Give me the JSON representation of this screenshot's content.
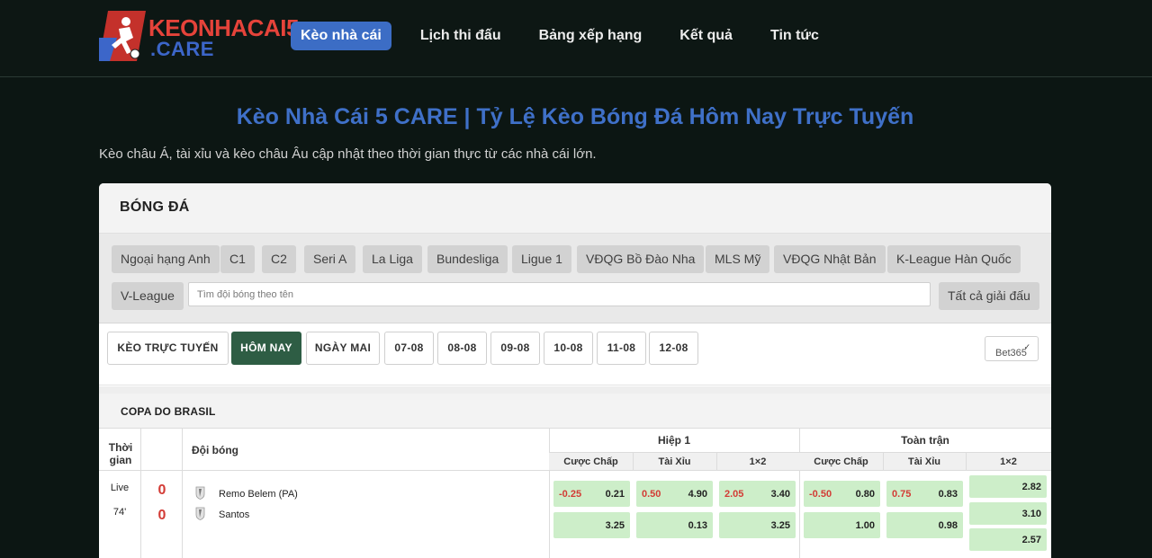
{
  "header": {
    "logo": {
      "line1": "KEONHACAI5",
      "line2": ".CARE"
    },
    "nav": [
      {
        "label": "Kèo nhà cái",
        "active": true
      },
      {
        "label": "Lịch thi đấu",
        "active": false
      },
      {
        "label": "Bảng xếp hạng",
        "active": false
      },
      {
        "label": "Kết quả",
        "active": false
      },
      {
        "label": "Tin tức",
        "active": false
      }
    ]
  },
  "page": {
    "title": "Kèo Nhà Cái 5 CARE | Tỷ Lệ Kèo Bóng Đá Hôm Nay Trực Tuyến",
    "description": "Kèo châu Á, tài xỉu và kèo châu Âu cập nhật theo thời gian thực từ các nhà cái lớn."
  },
  "card": {
    "title": "BÓNG ĐÁ",
    "leagues": [
      "Ngoại hạng Anh",
      "C1",
      "C2",
      "Seri A",
      "La Liga",
      "Bundesliga",
      "Ligue 1",
      "VĐQG Bồ Đào Nha",
      "MLS Mỹ",
      "VĐQG Nhật Bản",
      "K-League Hàn Quốc",
      "V-League"
    ],
    "search_placeholder": "Tìm đội bóng theo tên",
    "all_leagues": "Tất cả giải đấu",
    "date_tabs": [
      {
        "label": "KÈO TRỰC TUYẾN",
        "active": false
      },
      {
        "label": "HÔM NAY",
        "active": true
      },
      {
        "label": "NGÀY MAI",
        "active": false
      },
      {
        "label": "07-08",
        "active": false
      },
      {
        "label": "08-08",
        "active": false
      },
      {
        "label": "09-08",
        "active": false
      },
      {
        "label": "10-08",
        "active": false
      },
      {
        "label": "11-08",
        "active": false
      },
      {
        "label": "12-08",
        "active": false
      }
    ],
    "bookmaker": "Bet365"
  },
  "competition": {
    "name": "COPA DO BRASIL",
    "headers": {
      "time": "Thời gian",
      "teams": "Đội bóng",
      "half": "Hiệp 1",
      "full": "Toàn trận",
      "handicap": "Cược Chấp",
      "over_under": "Tài Xỉu",
      "one_x_two": "1×2"
    },
    "match": {
      "status": "Live",
      "minute": "74'",
      "home": {
        "name": "Remo Belem (PA)",
        "score": "0"
      },
      "away": {
        "name": "Santos",
        "score": "0"
      },
      "half": {
        "handicap": {
          "line": "-0.25",
          "home": "0.21",
          "away": "3.25"
        },
        "over_under": {
          "line": "0.50",
          "over": "4.90",
          "under": "0.13"
        },
        "one_x_two": {
          "line": "2.05",
          "home": "3.40",
          "away": "3.25"
        }
      },
      "full": {
        "handicap": {
          "line": "-0.50",
          "home": "0.80",
          "away": "1.00"
        },
        "over_under": {
          "line": "0.75",
          "over": "0.83",
          "under": "0.98"
        },
        "one_x_two": {
          "home": "2.82",
          "draw": "3.10",
          "away": "2.57"
        }
      }
    }
  }
}
